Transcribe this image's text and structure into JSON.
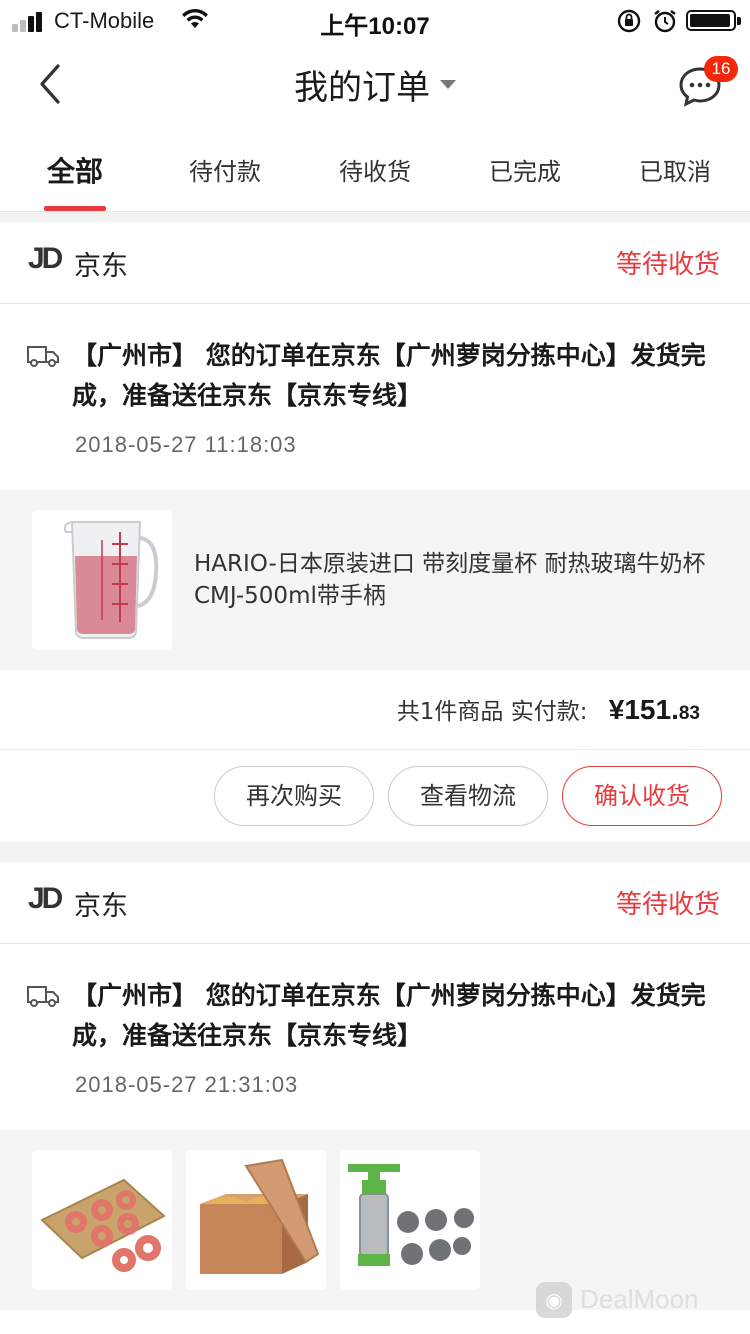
{
  "status_bar": {
    "carrier": "CT-Mobile",
    "time": "上午10:07"
  },
  "nav": {
    "title": "我的订单",
    "message_badge": "16"
  },
  "tabs": [
    {
      "label": "全部",
      "active": true
    },
    {
      "label": "待付款",
      "active": false
    },
    {
      "label": "待收货",
      "active": false
    },
    {
      "label": "已完成",
      "active": false
    },
    {
      "label": "已取消",
      "active": false
    }
  ],
  "orders": [
    {
      "shop_logo": "JD",
      "shop_name": "京东",
      "status": "等待收货",
      "tracking_text": "【广州市】 您的订单在京东【广州萝岗分拣中心】发货完成，准备送往京东【京东专线】",
      "tracking_time": "2018-05-27 11:18:03",
      "product_name": "HARIO-日本原装进口 带刻度量杯 耐热玻璃牛奶杯 CMJ-500ml带手柄",
      "summary_count": "共1件商品",
      "summary_label": "实付款:",
      "price_main": "¥151.",
      "price_cents": "83",
      "buttons": [
        "再次购买",
        "查看物流",
        "确认收货"
      ]
    },
    {
      "shop_logo": "JD",
      "shop_name": "京东",
      "status": "等待收货",
      "tracking_text": "【广州市】 您的订单在京东【广州萝岗分拣中心】发货完成，准备送往京东【京东专线】",
      "tracking_time": "2018-05-27 21:31:03"
    }
  ],
  "watermark": "DealMoon",
  "colors": {
    "accent": "#e93b3d",
    "badge": "#f2270c",
    "background": "#f2f2f2"
  }
}
